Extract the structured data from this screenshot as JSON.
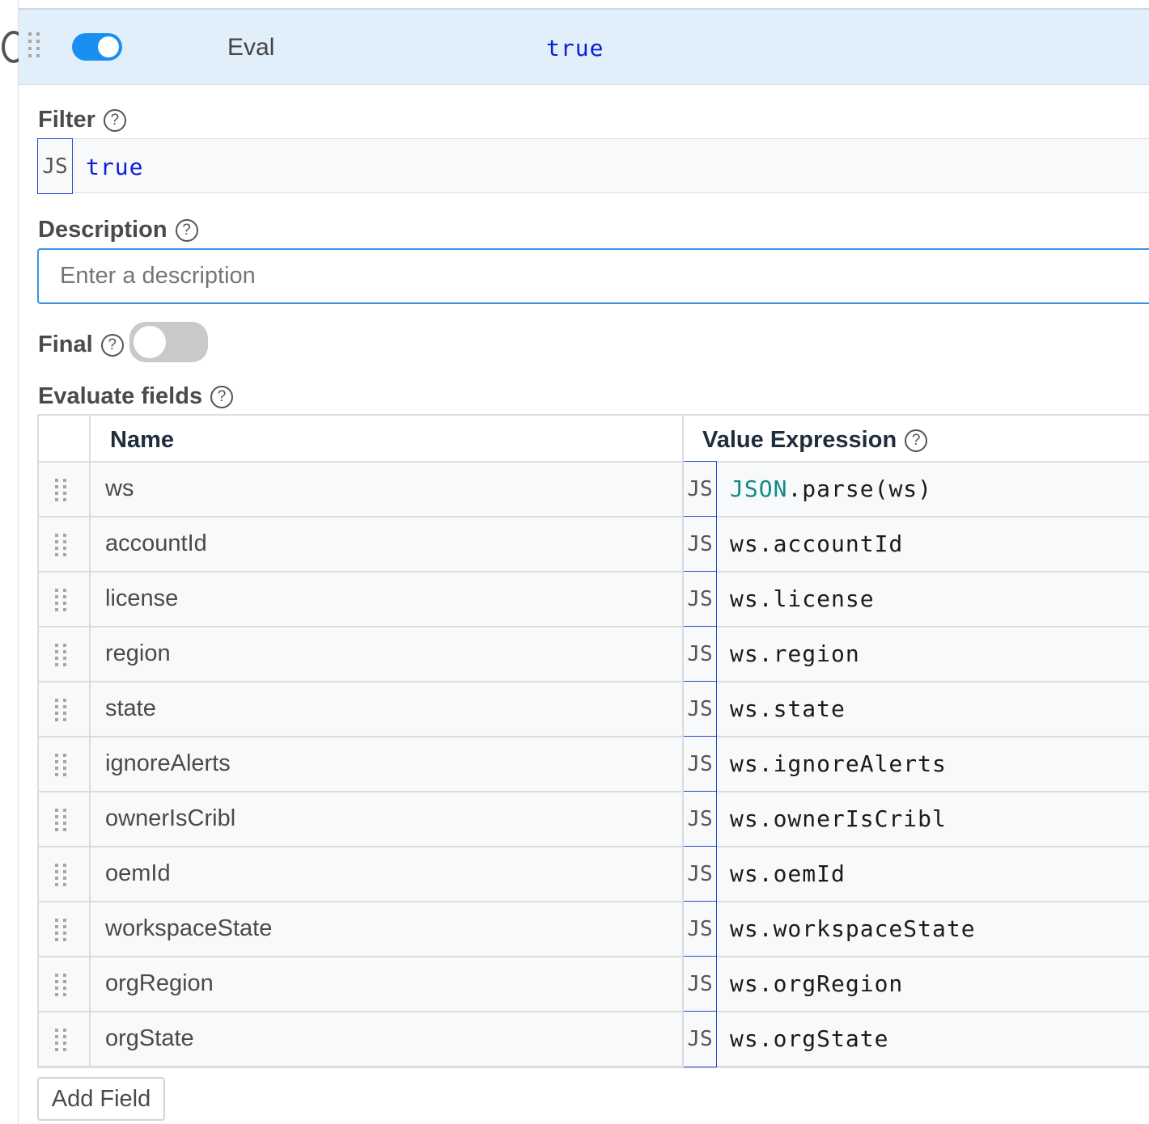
{
  "header": {
    "enabled": true,
    "function_name": "Eval",
    "filter_expression": "true"
  },
  "filter": {
    "label": "Filter",
    "help": "?",
    "lang_tag": "JS",
    "value": "true"
  },
  "description": {
    "label": "Description",
    "help": "?",
    "value": "",
    "placeholder": "Enter a description"
  },
  "final": {
    "label": "Final",
    "help": "?",
    "enabled": false
  },
  "evaluate_fields": {
    "label": "Evaluate fields",
    "help": "?",
    "columns": {
      "name": "Name",
      "value_expression": "Value Expression",
      "value_help": "?"
    },
    "rows": [
      {
        "name": "ws",
        "lang_tag": "JS",
        "expr_obj": "JSON",
        "expr_rest": ".parse(ws)"
      },
      {
        "name": "accountId",
        "lang_tag": "JS",
        "expr_obj": "",
        "expr_rest": "ws.accountId"
      },
      {
        "name": "license",
        "lang_tag": "JS",
        "expr_obj": "",
        "expr_rest": "ws.license"
      },
      {
        "name": "region",
        "lang_tag": "JS",
        "expr_obj": "",
        "expr_rest": "ws.region"
      },
      {
        "name": "state",
        "lang_tag": "JS",
        "expr_obj": "",
        "expr_rest": "ws.state"
      },
      {
        "name": "ignoreAlerts",
        "lang_tag": "JS",
        "expr_obj": "",
        "expr_rest": "ws.ignoreAlerts"
      },
      {
        "name": "ownerIsCribl",
        "lang_tag": "JS",
        "expr_obj": "",
        "expr_rest": "ws.ownerIsCribl"
      },
      {
        "name": "oemId",
        "lang_tag": "JS",
        "expr_obj": "",
        "expr_rest": "ws.oemId"
      },
      {
        "name": "workspaceState",
        "lang_tag": "JS",
        "expr_obj": "",
        "expr_rest": "ws.workspaceState"
      },
      {
        "name": "orgRegion",
        "lang_tag": "JS",
        "expr_obj": "",
        "expr_rest": "ws.orgRegion"
      },
      {
        "name": "orgState",
        "lang_tag": "JS",
        "expr_obj": "",
        "expr_rest": "ws.orgState"
      }
    ],
    "add_button": "Add Field"
  },
  "colors": {
    "accent": "#1a8ff2",
    "header_bg": "#e1effb",
    "js_border": "#2a45d6",
    "filter_text": "#0b1fd3",
    "json_keyword": "#138a86"
  },
  "icons": {
    "drag_handle": "drag-handle-icon",
    "help": "help-circle-icon"
  }
}
